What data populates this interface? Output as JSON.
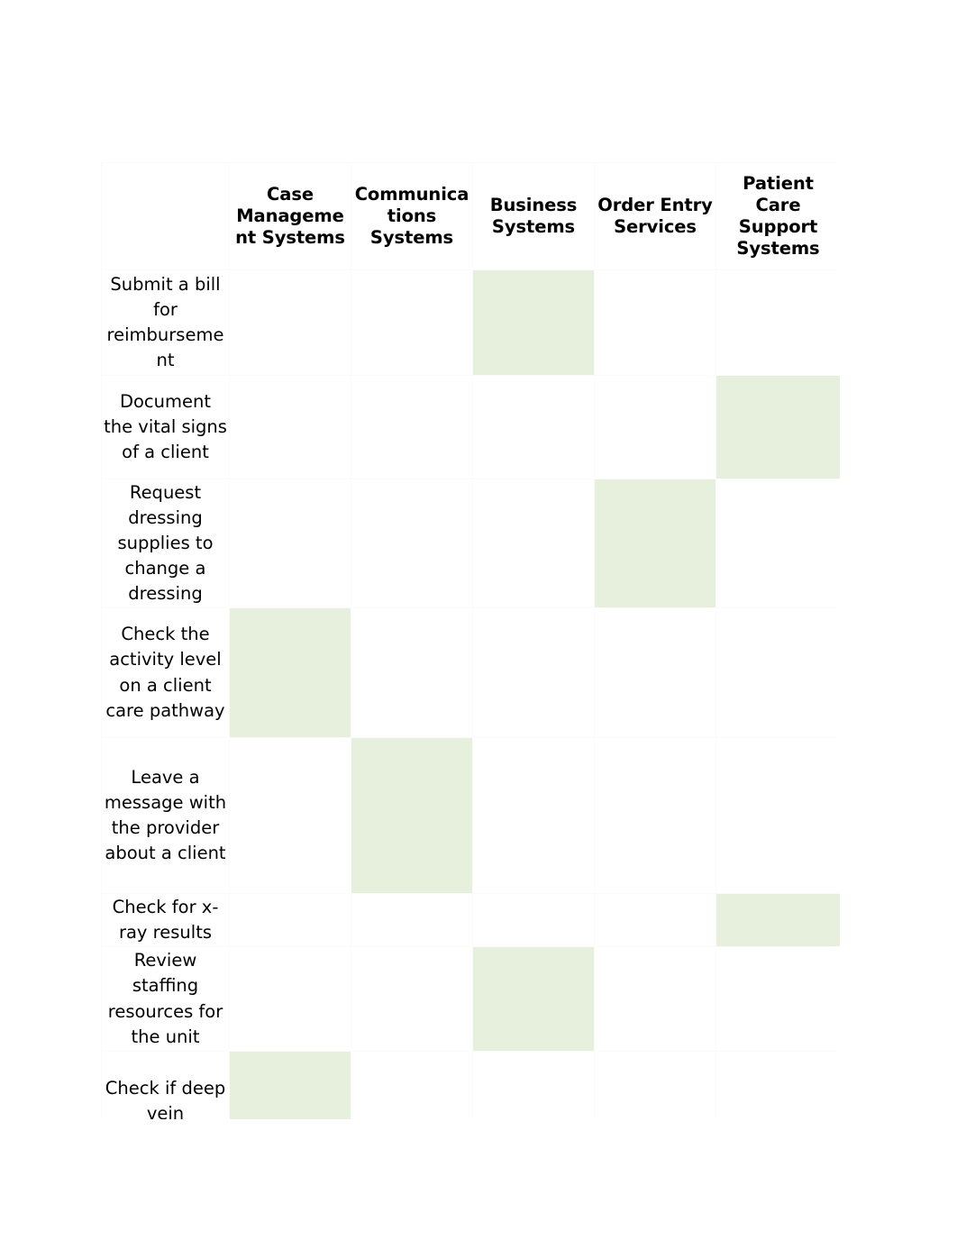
{
  "document": {
    "type": "matrix-table",
    "background_color": "#ffffff",
    "highlight_color": "#e6f0dd",
    "gridline_color": "#fbfbfb",
    "text_color": "#000000"
  },
  "table": {
    "corner_label": "",
    "columns": [
      "Case Management Systems",
      "Communications Systems",
      "Business Systems",
      "Order Entry Services",
      "Patient Care Support Systems"
    ],
    "rows": [
      {
        "label": "Submit a bill for reimbursement",
        "marks": [
          false,
          false,
          true,
          false,
          false
        ]
      },
      {
        "label": "Document the vital signs of a client",
        "marks": [
          false,
          false,
          false,
          false,
          true
        ]
      },
      {
        "label": "Request dressing supplies to change a dressing",
        "marks": [
          false,
          false,
          false,
          true,
          false
        ]
      },
      {
        "label": "Check the activity level on a client care pathway",
        "marks": [
          true,
          false,
          false,
          false,
          false
        ]
      },
      {
        "label": "Leave a message with the provider about a client",
        "marks": [
          false,
          true,
          false,
          false,
          false
        ]
      },
      {
        "label": "Check for x-ray results",
        "marks": [
          false,
          false,
          false,
          false,
          true
        ]
      },
      {
        "label": "Review staffing resources for the unit",
        "marks": [
          false,
          false,
          true,
          false,
          false
        ]
      },
      {
        "label": "Check if deep vein",
        "marks": [
          true,
          false,
          false,
          false,
          false
        ]
      }
    ]
  }
}
